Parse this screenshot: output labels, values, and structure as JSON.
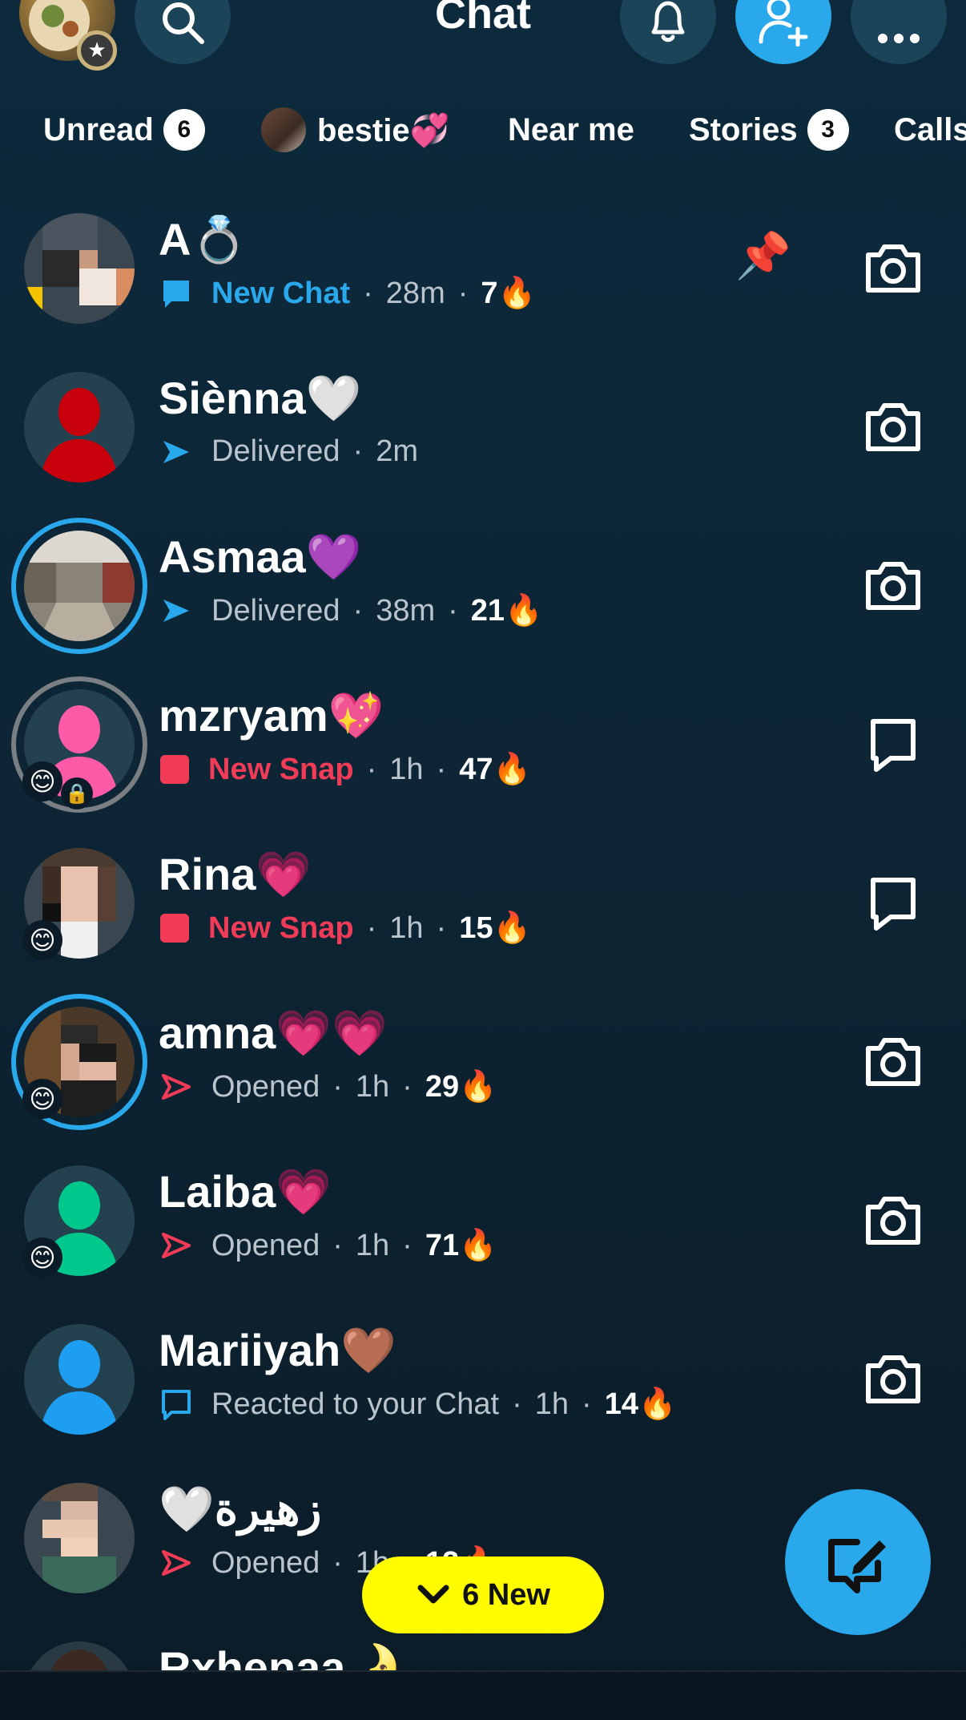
{
  "header": {
    "title": "Chat"
  },
  "tabs": [
    {
      "label": "Unread",
      "count": "6"
    },
    {
      "label": "bestie💞"
    },
    {
      "label": "Near me"
    },
    {
      "label": "Stories",
      "count": "3"
    },
    {
      "label": "Calls"
    }
  ],
  "chats": [
    {
      "name": "A💍",
      "status": "New Chat",
      "time": "28m",
      "streak": "7🔥",
      "pinned": true,
      "action": "camera"
    },
    {
      "name": "Siènna🤍",
      "status": "Delivered",
      "time": "2m",
      "action": "camera"
    },
    {
      "name": "Asmaa💜",
      "status": "Delivered",
      "time": "38m",
      "streak": "21🔥",
      "action": "camera"
    },
    {
      "name": "mzryam💖",
      "status": "New Snap",
      "time": "1h",
      "streak": "47🔥",
      "action": "chat"
    },
    {
      "name": "Rina💗",
      "status": "New Snap",
      "time": "1h",
      "streak": "15🔥",
      "action": "chat"
    },
    {
      "name": "amna💗💗",
      "status": "Opened",
      "time": "1h",
      "streak": "29🔥",
      "action": "camera"
    },
    {
      "name": "Laiba💗",
      "status": "Opened",
      "time": "1h",
      "streak": "71🔥",
      "action": "camera"
    },
    {
      "name": "Mariiyah🤎",
      "status": "Reacted to your Chat",
      "time": "1h",
      "streak": "14🔥",
      "action": "camera"
    },
    {
      "name": "🤍زهيرة",
      "status": "Opened",
      "time": "1h",
      "streak": "12🔥",
      "action": "camera"
    },
    {
      "name": "Rxhenaa🌛"
    }
  ],
  "new_pill": {
    "label": "6 New"
  },
  "colors": {
    "accent": "#2aa8ec",
    "snap_red": "#f23c57",
    "yellow": "#fffc00"
  },
  "icons": [
    "search-icon",
    "bell-icon",
    "add-friend-icon",
    "more-icon",
    "camera-icon",
    "chat-bubble-icon",
    "pin-icon",
    "compose-icon"
  ]
}
